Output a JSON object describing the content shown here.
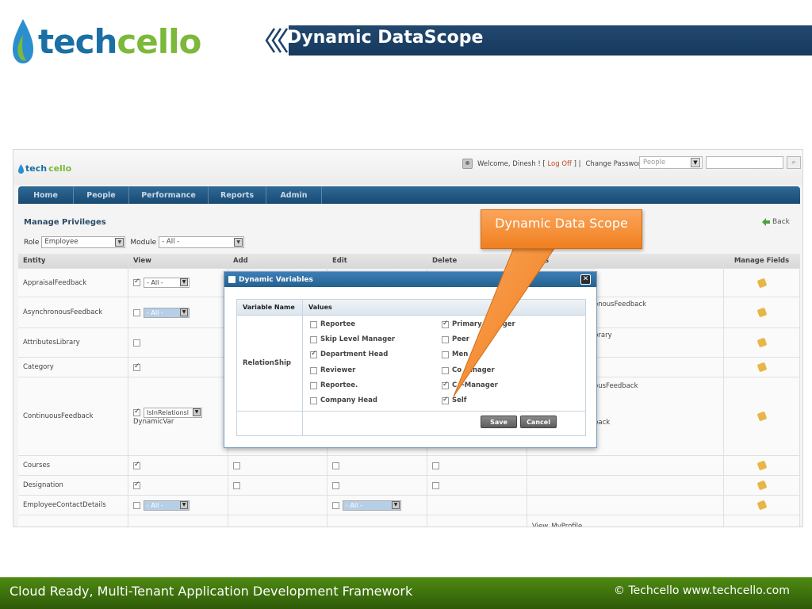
{
  "slide": {
    "logo_part1": "tech",
    "logo_part2": "cello",
    "title": "Dynamic DataScope",
    "callout": "Dynamic Data Scope",
    "footer_left": "Cloud Ready, Multi-Tenant Application Development Framework",
    "footer_right": "© Techcello www.techcello.com"
  },
  "app": {
    "logo_part1": "tech",
    "logo_part2": "cello",
    "welcome_text": "Welcome, Dinesh ! [",
    "logoff_label": "Log Off",
    "welcome_close": "]  |",
    "change_password_label": "Change Password",
    "search_scope": "People",
    "nav": [
      "Home",
      "People",
      "Performance",
      "Reports",
      "Admin"
    ],
    "page_title": "Manage Privileges",
    "back_label": "Back",
    "role_label": "Role",
    "role_value": "Employee",
    "module_label": "Module",
    "module_value": "- All -",
    "columns": [
      "Entity",
      "View",
      "Add",
      "Edit",
      "Delete",
      "Others",
      "Manage Fields"
    ],
    "others_col_text": "hers",
    "rows": [
      {
        "entity": "AppraisalFeedback",
        "view_select": "- All -"
      },
      {
        "entity": "AsynchronousFeedback",
        "view_select": "- All -",
        "others": "onousFeedback"
      },
      {
        "entity": "AttributesLibrary",
        "others": "brary"
      },
      {
        "entity": "Category"
      },
      {
        "entity": "ContinuousFeedback",
        "view_select": "IsInRelationsl",
        "view_extra": "DynamicVar",
        "others": "ousFeedback",
        "others2": "back"
      },
      {
        "entity": "Courses"
      },
      {
        "entity": "Designation"
      },
      {
        "entity": "EmployeeContactDetails",
        "view_select": "- All -",
        "edit_select": "- All -"
      },
      {
        "entity": "",
        "others": "View_MyProfile"
      }
    ]
  },
  "dialog": {
    "title": "Dynamic Variables",
    "col_variable": "Variable Name",
    "col_values": "Values",
    "variable": "RelationShip",
    "options_left": [
      {
        "label": "Reportee",
        "checked": false
      },
      {
        "label": "Skip Level Manager",
        "checked": false
      },
      {
        "label": "Department Head",
        "checked": true
      },
      {
        "label": "Reviewer",
        "checked": false
      },
      {
        "label": "Reportee.",
        "checked": false
      },
      {
        "label": "Company Head",
        "checked": false
      }
    ],
    "options_right": [
      {
        "label": "Primary",
        "label_tail": "ger",
        "checked": true
      },
      {
        "label": "Peer",
        "checked": false
      },
      {
        "label": "Men",
        "checked": false
      },
      {
        "label": "Co",
        "label_tail": "anager",
        "checked": false
      },
      {
        "label": "C",
        "label_tail": "-Manager",
        "checked": true
      },
      {
        "label": "Self",
        "checked": true
      }
    ],
    "save_label": "Save",
    "cancel_label": "Cancel"
  },
  "colors": {
    "title_bar": "#1d4269",
    "callout": "#f58a2a",
    "footer": "#3f7410",
    "nav": "#245987"
  },
  "icons": [
    "logo-drop-icon",
    "chevron-double-left-icon",
    "user-icon",
    "search-icon",
    "back-arrow-icon",
    "edit-icon",
    "dialog-icon",
    "close-icon",
    "checkbox-icon"
  ]
}
